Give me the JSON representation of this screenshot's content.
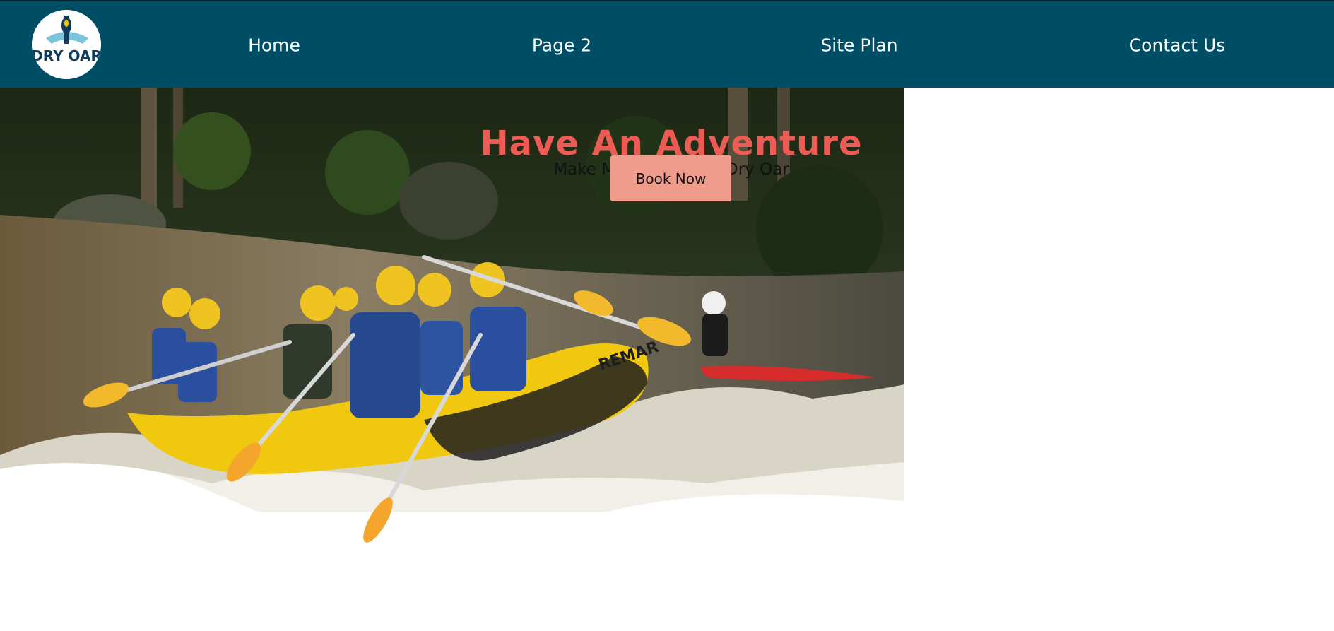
{
  "brand": {
    "logo_text": "DRY OAR"
  },
  "nav": {
    "items": [
      {
        "label": "Home"
      },
      {
        "label": "Page 2"
      },
      {
        "label": "Site Plan"
      },
      {
        "label": "Contact Us"
      }
    ]
  },
  "hero": {
    "headline": "Have An Adventure",
    "subheadline": "Make Memories with Dry Oar",
    "cta_label": "Book Now",
    "raft_brand": "REMAR"
  },
  "colors": {
    "header_bg": "#004d66",
    "headline": "#ec5c55",
    "cta_bg": "#ef9c8c",
    "page_bg": "#ffffff"
  },
  "icons": {
    "logo": "paddle-logo-icon"
  }
}
